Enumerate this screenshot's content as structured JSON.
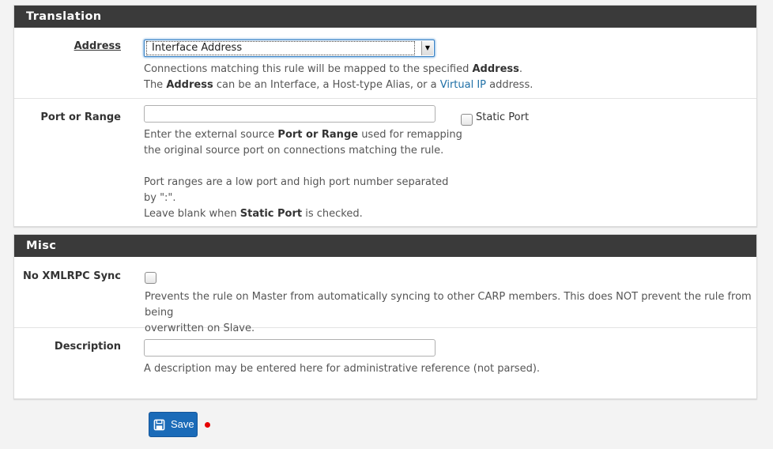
{
  "translation": {
    "title": "Translation",
    "address": {
      "label": "Address",
      "selected": "Interface Address",
      "help1_pre": "Connections matching this rule will be mapped to the specified ",
      "help1_bold": "Address",
      "help1_post": ".",
      "help2_pre": "The ",
      "help2_bold": "Address",
      "help2_mid": " can be an Interface, a Host-type Alias, or a ",
      "help2_link": "Virtual IP",
      "help2_post": " address."
    },
    "port": {
      "label": "Port or Range",
      "value": "",
      "static_port_label": "Static Port",
      "static_port_checked": false,
      "help1_pre": "Enter the external source ",
      "help1_bold": "Port or Range",
      "help1_post": " used for remapping",
      "help2": "the original source port on connections matching the rule.",
      "help3": "Port ranges are a low port and high port number separated",
      "help4": "by \":\".",
      "help5_pre": "Leave blank when ",
      "help5_bold": "Static Port",
      "help5_post": " is checked."
    }
  },
  "misc": {
    "title": "Misc",
    "xmlrpc": {
      "label": "No XMLRPC Sync",
      "checked": false,
      "help1": "Prevents the rule on Master from automatically syncing to other CARP members. This does NOT prevent the rule from being",
      "help2": "overwritten on Slave."
    },
    "description": {
      "label": "Description",
      "value": "",
      "help": "A description may be entered here for administrative reference (not parsed)."
    }
  },
  "actions": {
    "save_label": "Save",
    "save_icon": "floppy-disk-icon"
  },
  "colors": {
    "panel_header": "#3a3a3a",
    "primary_button": "#1b6bb8",
    "link": "#1e6fa6",
    "required_dot": "#e60000"
  }
}
